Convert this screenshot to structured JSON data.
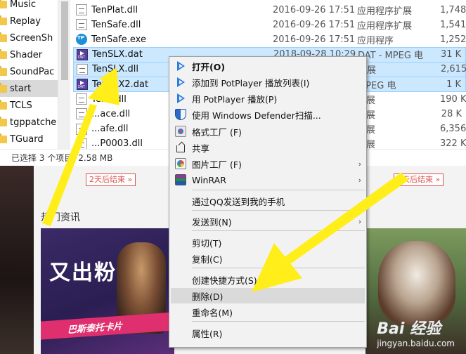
{
  "nav_pane": {
    "items": [
      {
        "label": "Music",
        "selected": false
      },
      {
        "label": "Replay",
        "selected": false
      },
      {
        "label": "ScreenSh",
        "selected": false
      },
      {
        "label": "Shader",
        "selected": false
      },
      {
        "label": "SoundPac",
        "selected": false
      },
      {
        "label": "start",
        "selected": true
      },
      {
        "label": "TCLS",
        "selected": false
      },
      {
        "label": "tgppatche",
        "selected": false
      },
      {
        "label": "TGuard",
        "selected": false
      }
    ]
  },
  "file_list": {
    "rows": [
      {
        "name": "TenPlat.dll",
        "date": "2016-09-26 17:51",
        "type": "应用程序扩展",
        "size": "1,748 K",
        "icon": "dll-file-icon",
        "selected": false
      },
      {
        "name": "TenSafe.dll",
        "date": "2016-09-26 17:51",
        "type": "应用程序扩展",
        "size": "1,541 K",
        "icon": "dll-file-icon",
        "selected": false
      },
      {
        "name": "TenSafe.exe",
        "date": "2016-09-26 17:51",
        "type": "应用程序",
        "size": "1,252 K",
        "icon": "exe-file-icon",
        "selected": false
      },
      {
        "name": "TenSLX.dat",
        "date": "2018-09-28 10:29",
        "type": "DAT - MPEG 电",
        "size": "31 K",
        "icon": "dat-file-icon",
        "selected": true
      },
      {
        "name": "TenSLX.dll",
        "date": "",
        "type": "扩展",
        "size": "2,615 K",
        "icon": "dll-file-icon",
        "selected": true
      },
      {
        "name": "TenSLX2.dat",
        "date": "",
        "type": "MPEG 电",
        "size": "1 K",
        "icon": "dat-file-icon",
        "selected": true
      },
      {
        "name": "Ten...dll",
        "date": "",
        "type": "扩展",
        "size": "190 K",
        "icon": "dll-file-icon",
        "selected": false
      },
      {
        "name": "...ace.dll",
        "date": "",
        "type": "扩展",
        "size": "28 K",
        "icon": "dll-file-icon",
        "selected": false
      },
      {
        "name": "...afe.dll",
        "date": "",
        "type": "扩展",
        "size": "6,356 K",
        "icon": "dll-file-icon",
        "selected": false
      },
      {
        "name": "...P0003.dll",
        "date": "",
        "type": "扩展",
        "size": "322 K",
        "icon": "dll-file-icon",
        "selected": false
      }
    ]
  },
  "status_bar": {
    "selected_text": "已选择 3 个项目",
    "size_text": "2.58 MB"
  },
  "context_menu": {
    "items": [
      {
        "label": "打开(O)",
        "icon": "play-icon",
        "bold": true,
        "submenu": false,
        "hover": false
      },
      {
        "label": "添加到 PotPlayer 播放列表(I)",
        "icon": "play-icon",
        "bold": false,
        "submenu": false,
        "hover": false
      },
      {
        "label": "用 PotPlayer 播放(P)",
        "icon": "play-icon",
        "bold": false,
        "submenu": false,
        "hover": false
      },
      {
        "label": "使用 Windows Defender扫描...",
        "icon": "shield-icon",
        "bold": false,
        "submenu": false,
        "hover": false
      },
      {
        "label": "格式工厂 (F)",
        "icon": "factory-icon",
        "bold": false,
        "submenu": false,
        "hover": false
      },
      {
        "label": "共享",
        "icon": "share-icon",
        "bold": false,
        "submenu": false,
        "hover": false
      },
      {
        "label": "图片工厂 (F)",
        "icon": "picture-icon",
        "bold": false,
        "submenu": true,
        "hover": false
      },
      {
        "label": "WinRAR",
        "icon": "winrar-icon",
        "bold": false,
        "submenu": true,
        "hover": false
      },
      {
        "label": "通过QQ发送到我的手机",
        "icon": "",
        "bold": false,
        "submenu": false,
        "hover": false
      },
      {
        "label": "发送到(N)",
        "icon": "",
        "bold": false,
        "submenu": true,
        "hover": false
      },
      {
        "label": "剪切(T)",
        "icon": "",
        "bold": false,
        "submenu": false,
        "hover": false
      },
      {
        "label": "复制(C)",
        "icon": "",
        "bold": false,
        "submenu": false,
        "hover": false
      },
      {
        "label": "创建快捷方式(S)",
        "icon": "",
        "bold": false,
        "submenu": false,
        "hover": false
      },
      {
        "label": "删除(D)",
        "icon": "",
        "bold": false,
        "submenu": false,
        "hover": true
      },
      {
        "label": "重命名(M)",
        "icon": "",
        "bold": false,
        "submenu": false,
        "hover": false
      },
      {
        "label": "属性(R)",
        "icon": "",
        "bold": false,
        "submenu": false,
        "hover": false
      }
    ],
    "submenu_glyph": "›"
  },
  "webpage": {
    "section_title": "热门资讯",
    "timer_left": "2天后结束 »",
    "timer_right": "2天后结束 »",
    "banner_title": "又出粉",
    "banner_ribbon": "巴斯泰托卡片"
  },
  "watermark": {
    "logo": "Bai 经验",
    "url": "jingyan.baidu.com"
  },
  "colors": {
    "selection_bg": "#cce8ff",
    "menu_bg": "#f2f2f2",
    "arrow_yellow": "#ffee1a"
  }
}
